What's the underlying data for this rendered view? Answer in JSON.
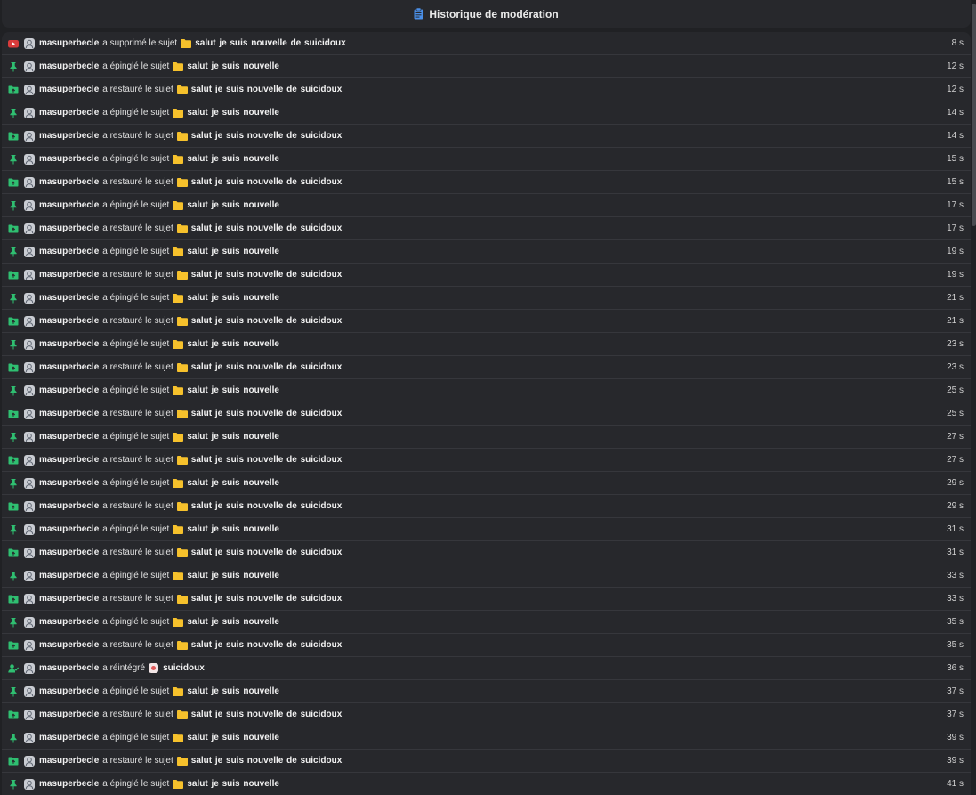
{
  "header": {
    "title": "Historique de modération"
  },
  "colors": {
    "delete": "#d93b3b",
    "pin": "#2fbf71",
    "restore": "#2fbf71",
    "reinstate": "#2fbf71",
    "folder": "#f6c12c"
  },
  "log": [
    {
      "type": "delete",
      "icon": "youtube-delete-icon",
      "user": "masuperbecle",
      "verb": "a supprimé le sujet",
      "target": "salut je suis nouvelle de suicidoux",
      "time": "8 s"
    },
    {
      "type": "pin",
      "icon": "pin-icon",
      "user": "masuperbecle",
      "verb": "a épinglé le sujet",
      "target": "salut je suis nouvelle",
      "time": "12 s"
    },
    {
      "type": "restore",
      "icon": "folder-restore-icon",
      "user": "masuperbecle",
      "verb": "a restauré le sujet",
      "target": "salut je suis nouvelle de suicidoux",
      "time": "12 s"
    },
    {
      "type": "pin",
      "icon": "pin-icon",
      "user": "masuperbecle",
      "verb": "a épinglé le sujet",
      "target": "salut je suis nouvelle",
      "time": "14 s"
    },
    {
      "type": "restore",
      "icon": "folder-restore-icon",
      "user": "masuperbecle",
      "verb": "a restauré le sujet",
      "target": "salut je suis nouvelle de suicidoux",
      "time": "14 s"
    },
    {
      "type": "pin",
      "icon": "pin-icon",
      "user": "masuperbecle",
      "verb": "a épinglé le sujet",
      "target": "salut je suis nouvelle",
      "time": "15 s"
    },
    {
      "type": "restore",
      "icon": "folder-restore-icon",
      "user": "masuperbecle",
      "verb": "a restauré le sujet",
      "target": "salut je suis nouvelle de suicidoux",
      "time": "15 s"
    },
    {
      "type": "pin",
      "icon": "pin-icon",
      "user": "masuperbecle",
      "verb": "a épinglé le sujet",
      "target": "salut je suis nouvelle",
      "time": "17 s"
    },
    {
      "type": "restore",
      "icon": "folder-restore-icon",
      "user": "masuperbecle",
      "verb": "a restauré le sujet",
      "target": "salut je suis nouvelle de suicidoux",
      "time": "17 s"
    },
    {
      "type": "pin",
      "icon": "pin-icon",
      "user": "masuperbecle",
      "verb": "a épinglé le sujet",
      "target": "salut je suis nouvelle",
      "time": "19 s"
    },
    {
      "type": "restore",
      "icon": "folder-restore-icon",
      "user": "masuperbecle",
      "verb": "a restauré le sujet",
      "target": "salut je suis nouvelle de suicidoux",
      "time": "19 s"
    },
    {
      "type": "pin",
      "icon": "pin-icon",
      "user": "masuperbecle",
      "verb": "a épinglé le sujet",
      "target": "salut je suis nouvelle",
      "time": "21 s"
    },
    {
      "type": "restore",
      "icon": "folder-restore-icon",
      "user": "masuperbecle",
      "verb": "a restauré le sujet",
      "target": "salut je suis nouvelle de suicidoux",
      "time": "21 s"
    },
    {
      "type": "pin",
      "icon": "pin-icon",
      "user": "masuperbecle",
      "verb": "a épinglé le sujet",
      "target": "salut je suis nouvelle",
      "time": "23 s"
    },
    {
      "type": "restore",
      "icon": "folder-restore-icon",
      "user": "masuperbecle",
      "verb": "a restauré le sujet",
      "target": "salut je suis nouvelle de suicidoux",
      "time": "23 s"
    },
    {
      "type": "pin",
      "icon": "pin-icon",
      "user": "masuperbecle",
      "verb": "a épinglé le sujet",
      "target": "salut je suis nouvelle",
      "time": "25 s"
    },
    {
      "type": "restore",
      "icon": "folder-restore-icon",
      "user": "masuperbecle",
      "verb": "a restauré le sujet",
      "target": "salut je suis nouvelle de suicidoux",
      "time": "25 s"
    },
    {
      "type": "pin",
      "icon": "pin-icon",
      "user": "masuperbecle",
      "verb": "a épinglé le sujet",
      "target": "salut je suis nouvelle",
      "time": "27 s"
    },
    {
      "type": "restore",
      "icon": "folder-restore-icon",
      "user": "masuperbecle",
      "verb": "a restauré le sujet",
      "target": "salut je suis nouvelle de suicidoux",
      "time": "27 s"
    },
    {
      "type": "pin",
      "icon": "pin-icon",
      "user": "masuperbecle",
      "verb": "a épinglé le sujet",
      "target": "salut je suis nouvelle",
      "time": "29 s"
    },
    {
      "type": "restore",
      "icon": "folder-restore-icon",
      "user": "masuperbecle",
      "verb": "a restauré le sujet",
      "target": "salut je suis nouvelle de suicidoux",
      "time": "29 s"
    },
    {
      "type": "pin",
      "icon": "pin-icon",
      "user": "masuperbecle",
      "verb": "a épinglé le sujet",
      "target": "salut je suis nouvelle",
      "time": "31 s"
    },
    {
      "type": "restore",
      "icon": "folder-restore-icon",
      "user": "masuperbecle",
      "verb": "a restauré le sujet",
      "target": "salut je suis nouvelle de suicidoux",
      "time": "31 s"
    },
    {
      "type": "pin",
      "icon": "pin-icon",
      "user": "masuperbecle",
      "verb": "a épinglé le sujet",
      "target": "salut je suis nouvelle",
      "time": "33 s"
    },
    {
      "type": "restore",
      "icon": "folder-restore-icon",
      "user": "masuperbecle",
      "verb": "a restauré le sujet",
      "target": "salut je suis nouvelle de suicidoux",
      "time": "33 s"
    },
    {
      "type": "pin",
      "icon": "pin-icon",
      "user": "masuperbecle",
      "verb": "a épinglé le sujet",
      "target": "salut je suis nouvelle",
      "time": "35 s"
    },
    {
      "type": "restore",
      "icon": "folder-restore-icon",
      "user": "masuperbecle",
      "verb": "a restauré le sujet",
      "target": "salut je suis nouvelle de suicidoux",
      "time": "35 s"
    },
    {
      "type": "reinstate",
      "icon": "user-check-icon",
      "user": "masuperbecle",
      "verb": "a réintégré",
      "target": "suicidoux",
      "time": "36 s"
    },
    {
      "type": "pin",
      "icon": "pin-icon",
      "user": "masuperbecle",
      "verb": "a épinglé le sujet",
      "target": "salut je suis nouvelle",
      "time": "37 s"
    },
    {
      "type": "restore",
      "icon": "folder-restore-icon",
      "user": "masuperbecle",
      "verb": "a restauré le sujet",
      "target": "salut je suis nouvelle de suicidoux",
      "time": "37 s"
    },
    {
      "type": "pin",
      "icon": "pin-icon",
      "user": "masuperbecle",
      "verb": "a épinglé le sujet",
      "target": "salut je suis nouvelle",
      "time": "39 s"
    },
    {
      "type": "restore",
      "icon": "folder-restore-icon",
      "user": "masuperbecle",
      "verb": "a restauré le sujet",
      "target": "salut je suis nouvelle de suicidoux",
      "time": "39 s"
    },
    {
      "type": "pin",
      "icon": "pin-icon",
      "user": "masuperbecle",
      "verb": "a épinglé le sujet",
      "target": "salut je suis nouvelle",
      "time": "41 s"
    }
  ]
}
